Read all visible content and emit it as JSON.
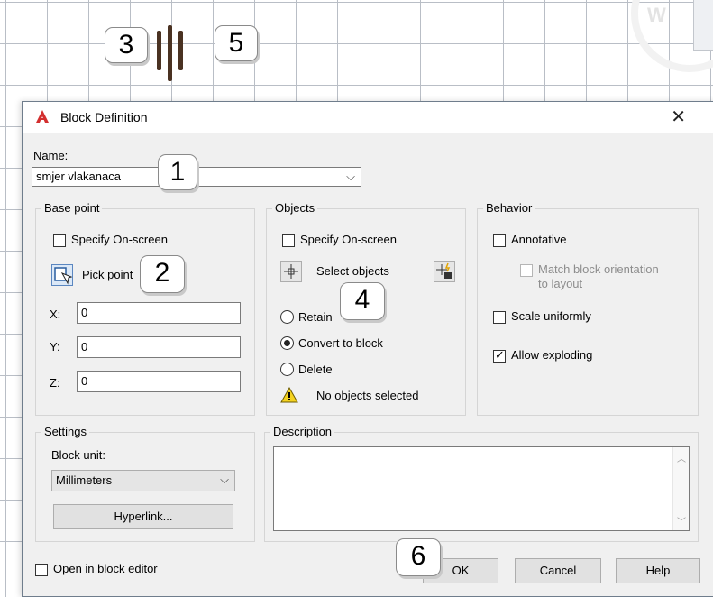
{
  "annotations": {
    "n1": "1",
    "n2": "2",
    "n3": "3",
    "n4": "4",
    "n5": "5",
    "n6": "6"
  },
  "canvas": {
    "corner_glyph": "W"
  },
  "dialog": {
    "title": "Block Definition",
    "close_glyph": "✕",
    "name": {
      "label": "Name:",
      "value": "smjer vlakanaca",
      "arrow": "⌵"
    },
    "base_point": {
      "group_label": "Base point",
      "specify_label": "Specify On-screen",
      "specify_checked": false,
      "pick_point_label": "Pick point",
      "x_label": "X:",
      "x_value": "0",
      "y_label": "Y:",
      "y_value": "0",
      "z_label": "Z:",
      "z_value": "0"
    },
    "objects": {
      "group_label": "Objects",
      "specify_label": "Specify On-screen",
      "specify_checked": false,
      "select_objects_label": "Select objects",
      "retain_label": "Retain",
      "convert_label": "Convert to block",
      "delete_label": "Delete",
      "selected_option": "Convert to block",
      "warning_text": "No objects selected"
    },
    "behavior": {
      "group_label": "Behavior",
      "annotative_label": "Annotative",
      "annotative_checked": false,
      "match_label_line1": "Match block orientation",
      "match_label_line2": "to layout",
      "match_checked": false,
      "scale_label": "Scale uniformly",
      "scale_checked": false,
      "explode_label": "Allow exploding",
      "explode_checked": true
    },
    "settings": {
      "group_label": "Settings",
      "block_unit_label": "Block unit:",
      "block_unit_value": "Millimeters",
      "hyperlink_label": "Hyperlink..."
    },
    "description": {
      "group_label": "Description",
      "value": ""
    },
    "footer": {
      "open_editor_label": "Open in block editor",
      "open_editor_checked": false,
      "ok_label": "OK",
      "cancel_label": "Cancel",
      "help_label": "Help"
    }
  }
}
